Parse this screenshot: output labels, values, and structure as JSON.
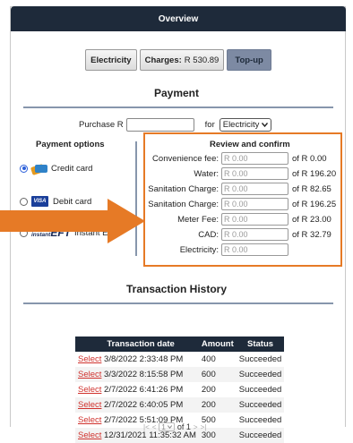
{
  "header": {
    "title": "Overview"
  },
  "top_buttons": {
    "electricity": "Electricity",
    "charges_label": "Charges:",
    "charges_value": "R 530.89",
    "topup": "Top-up"
  },
  "payment": {
    "title": "Payment",
    "purchase_label": "Purchase R",
    "purchase_value": "",
    "for_label": "for",
    "utility_selected": "Electricity"
  },
  "payment_options": {
    "title": "Payment options",
    "credit": "Credit card",
    "debit": "Debit card",
    "eft_brand_small": "instant",
    "eft_brand_large": "EFT",
    "eft": "Instant EFT",
    "visa_text": "VISA"
  },
  "review": {
    "title": "Review and confirm",
    "rows": [
      {
        "label": "Convenience fee:",
        "value": "R 0.00",
        "of": "of R 0.00"
      },
      {
        "label": "Water:",
        "value": "R 0.00",
        "of": "of R 196.20"
      },
      {
        "label": "Sanitation Charge:",
        "value": "R 0.00",
        "of": "of R 82.65"
      },
      {
        "label": "Sanitation Charge:",
        "value": "R 0.00",
        "of": "of R 196.25"
      },
      {
        "label": "Meter Fee:",
        "value": "R 0.00",
        "of": "of R 23.00"
      },
      {
        "label": "CAD:",
        "value": "R 0.00",
        "of": "of R 32.79"
      },
      {
        "label": "Electricity:",
        "value": "R 0.00",
        "of": ""
      }
    ]
  },
  "transactions": {
    "title": "Transaction History",
    "columns": [
      "",
      "Transaction date",
      "Amount",
      "Status"
    ],
    "rows": [
      {
        "action": "Select",
        "date": "3/8/2022 2:33:48 PM",
        "amount": "400",
        "status": "Succeeded"
      },
      {
        "action": "Select",
        "date": "3/3/2022 8:15:58 PM",
        "amount": "600",
        "status": "Succeeded"
      },
      {
        "action": "Select",
        "date": "2/7/2022 6:41:26 PM",
        "amount": "200",
        "status": "Succeeded"
      },
      {
        "action": "Select",
        "date": "2/7/2022 6:40:05 PM",
        "amount": "200",
        "status": "Succeeded"
      },
      {
        "action": "Select",
        "date": "2/7/2022 5:51:09 PM",
        "amount": "500",
        "status": "Succeeded"
      },
      {
        "action": "Select",
        "date": "12/31/2021 11:35:32 AM",
        "amount": "300",
        "status": "Succeeded"
      }
    ]
  },
  "pager": {
    "first": "|<",
    "prev": "<",
    "page": "1",
    "of_label": "of 1",
    "next": ">",
    "last": ">|"
  },
  "colors": {
    "header_bg": "#1e2a3a",
    "accent_orange": "#e67a26",
    "link_red": "#d0322e",
    "topup_bg": "#7d8aa3"
  },
  "icons": {
    "arrow": "arrow-right-icon",
    "credit": "credit-card-icon",
    "debit": "visa-card-icon",
    "eft": "instant-eft-logo-icon"
  }
}
